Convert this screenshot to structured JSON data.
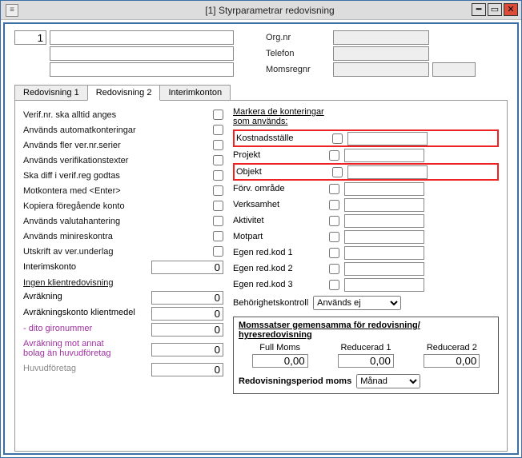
{
  "window": {
    "title": "[1]  Styrparametrar redovisning"
  },
  "top": {
    "num": "1",
    "orgnr_label": "Org.nr",
    "telefon_label": "Telefon",
    "momsregnr_label": "Momsregnr"
  },
  "tabs": {
    "t1": "Redovisning 1",
    "t2": "Redovisning 2",
    "t3": "Interimkonton"
  },
  "leftChecks": [
    "Verif.nr. ska alltid anges",
    "Används automatkonteringar",
    "Används fler ver.nr.serier",
    "Används verifikationstexter",
    "Ska diff i verif.reg godtas",
    "Motkontera med <Enter>",
    "Kopiera föregående konto",
    "Används valutahantering",
    "Används minireskontra",
    "Utskrift av ver.underlag"
  ],
  "interimskonto": {
    "label": "Interimskonto",
    "value": "0"
  },
  "klient": {
    "heading": "Ingen klientredovisning",
    "rows": [
      {
        "label": "Avräkning",
        "value": "0",
        "cls": ""
      },
      {
        "label": "Avräkningskonto klientmedel",
        "value": "0",
        "cls": ""
      },
      {
        "label": "- dito gironummer",
        "value": "0",
        "cls": "purple"
      },
      {
        "label": "Avräkning mot annat\nbolag än huvudföretag",
        "value": "0",
        "cls": "purple"
      },
      {
        "label": "Huvudföretag",
        "value": "0",
        "cls": "gray"
      }
    ]
  },
  "rightHead1": "Markera de konteringar",
  "rightHead2": "som används:",
  "kont": [
    {
      "label": "Kostnadsställe",
      "hl": true
    },
    {
      "label": "Projekt",
      "hl": false
    },
    {
      "label": "Objekt",
      "hl": true
    },
    {
      "label": "Förv. område",
      "hl": false
    },
    {
      "label": "Verksamhet",
      "hl": false
    },
    {
      "label": "Aktivitet",
      "hl": false
    },
    {
      "label": "Motpart",
      "hl": false
    },
    {
      "label": "Egen red.kod 1",
      "hl": false
    },
    {
      "label": "Egen red.kod 2",
      "hl": false
    },
    {
      "label": "Egen red.kod 3",
      "hl": false
    }
  ],
  "beh": {
    "label": "Behörighetskontroll",
    "value": "Används ej"
  },
  "moms": {
    "heading": "Momssatser gemensamma för redovisning/ hyresredovisning",
    "cols": [
      {
        "label": "Full Moms",
        "value": "0,00"
      },
      {
        "label": "Reducerad 1",
        "value": "0,00"
      },
      {
        "label": "Reducerad 2",
        "value": "0,00"
      }
    ],
    "period_label": "Redovisningsperiod moms",
    "period_value": "Månad"
  }
}
